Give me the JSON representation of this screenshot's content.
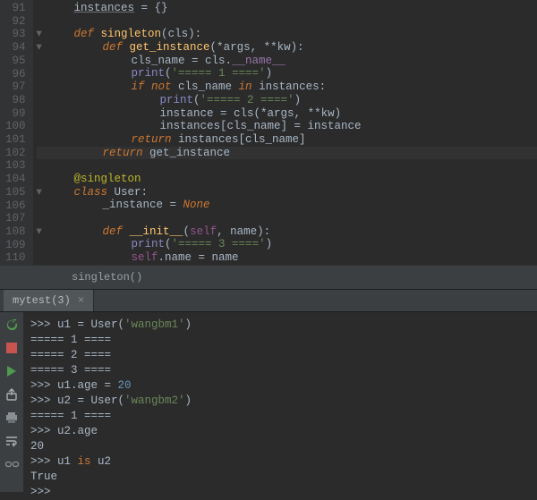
{
  "gutter": {
    "start": 91,
    "end": 110,
    "highlighted": 102
  },
  "code_lines": [
    {
      "n": 91,
      "indent": 1,
      "tokens": [
        [
          "txt und",
          "instances"
        ],
        [
          "txt",
          " = {}"
        ]
      ]
    },
    {
      "n": 92,
      "indent": 1,
      "tokens": []
    },
    {
      "n": 93,
      "indent": 1,
      "fold": true,
      "tokens": [
        [
          "kw",
          "def "
        ],
        [
          "fn",
          "singleton"
        ],
        [
          "txt",
          "("
        ],
        [
          "par",
          "cls"
        ],
        [
          "txt",
          ")"
        ],
        [
          "op",
          ":"
        ]
      ]
    },
    {
      "n": 94,
      "indent": 2,
      "fold": true,
      "tokens": [
        [
          "kw",
          "def "
        ],
        [
          "fn",
          "get_instance"
        ],
        [
          "txt",
          "(*"
        ],
        [
          "par",
          "args"
        ],
        [
          "op",
          ", "
        ],
        [
          "txt",
          "**"
        ],
        [
          "par",
          "kw"
        ],
        [
          "txt",
          ")"
        ],
        [
          "op",
          ":"
        ]
      ]
    },
    {
      "n": 95,
      "indent": 3,
      "tokens": [
        [
          "txt",
          "cls_name = cls."
        ],
        [
          "prp",
          "__name__"
        ]
      ]
    },
    {
      "n": 96,
      "indent": 3,
      "tokens": [
        [
          "bi",
          "print"
        ],
        [
          "txt",
          "("
        ],
        [
          "str",
          "'===== 1 ===='"
        ],
        [
          "txt",
          ")"
        ]
      ]
    },
    {
      "n": 97,
      "indent": 3,
      "tokens": [
        [
          "kw",
          "if not "
        ],
        [
          "txt",
          "cls_name "
        ],
        [
          "kw",
          "in "
        ],
        [
          "txt",
          "instances"
        ],
        [
          "op",
          ":"
        ]
      ]
    },
    {
      "n": 98,
      "indent": 4,
      "tokens": [
        [
          "bi",
          "print"
        ],
        [
          "txt",
          "("
        ],
        [
          "str",
          "'===== 2 ===='"
        ],
        [
          "txt",
          ")"
        ]
      ]
    },
    {
      "n": 99,
      "indent": 4,
      "tokens": [
        [
          "txt",
          "instance = cls(*args"
        ],
        [
          "op",
          ", "
        ],
        [
          "txt",
          "**kw)"
        ]
      ]
    },
    {
      "n": 100,
      "indent": 4,
      "tokens": [
        [
          "txt",
          "instances[cls_name] = instance"
        ]
      ]
    },
    {
      "n": 101,
      "indent": 3,
      "tokens": [
        [
          "kw",
          "return "
        ],
        [
          "txt",
          "instances[cls_name]"
        ]
      ]
    },
    {
      "n": 102,
      "indent": 2,
      "hl": true,
      "tokens": [
        [
          "kw",
          "return "
        ],
        [
          "txt",
          "get_instance"
        ]
      ]
    },
    {
      "n": 103,
      "indent": 1,
      "tokens": []
    },
    {
      "n": 104,
      "indent": 1,
      "tokens": [
        [
          "dec",
          "@singleton"
        ]
      ]
    },
    {
      "n": 105,
      "indent": 1,
      "fold": true,
      "tokens": [
        [
          "kw",
          "class "
        ],
        [
          "txt",
          "User"
        ],
        [
          "op",
          ":"
        ]
      ]
    },
    {
      "n": 106,
      "indent": 2,
      "tokens": [
        [
          "txt",
          "_instance = "
        ],
        [
          "kw",
          "None"
        ]
      ]
    },
    {
      "n": 107,
      "indent": 1,
      "tokens": []
    },
    {
      "n": 108,
      "indent": 2,
      "fold": true,
      "tokens": [
        [
          "kw",
          "def "
        ],
        [
          "fn",
          "__init__"
        ],
        [
          "txt",
          "("
        ],
        [
          "slf",
          "self"
        ],
        [
          "op",
          ", "
        ],
        [
          "par",
          "name"
        ],
        [
          "txt",
          ")"
        ],
        [
          "op",
          ":"
        ]
      ]
    },
    {
      "n": 109,
      "indent": 3,
      "tokens": [
        [
          "bi",
          "print"
        ],
        [
          "txt",
          "("
        ],
        [
          "str",
          "'===== 3 ===='"
        ],
        [
          "txt",
          ")"
        ]
      ]
    },
    {
      "n": 110,
      "indent": 3,
      "tokens": [
        [
          "slf",
          "self"
        ],
        [
          "txt",
          ".name = name"
        ]
      ]
    }
  ],
  "breadcrumb": "singleton()",
  "tab": {
    "label": "mytest(3)"
  },
  "console_lines": [
    [
      [
        "prompt",
        ">>> "
      ],
      [
        "c-var",
        "u1 = User("
      ],
      [
        "c-str",
        "'wangbm1'"
      ],
      [
        "c-var",
        ")"
      ]
    ],
    [
      [
        "c-out",
        "===== 1 ===="
      ]
    ],
    [
      [
        "c-out",
        "===== 2 ===="
      ]
    ],
    [
      [
        "c-out",
        "===== 3 ===="
      ]
    ],
    [
      [
        "prompt",
        ">>> "
      ],
      [
        "c-var",
        "u1.age = "
      ],
      [
        "c-num",
        "20"
      ]
    ],
    [
      [
        "prompt",
        ">>> "
      ],
      [
        "c-var",
        "u2 = User("
      ],
      [
        "c-str",
        "'wangbm2'"
      ],
      [
        "c-var",
        ")"
      ]
    ],
    [
      [
        "c-out",
        "===== 1 ===="
      ]
    ],
    [
      [
        "prompt",
        ">>> "
      ],
      [
        "c-var",
        "u2.age"
      ]
    ],
    [
      [
        "c-out",
        "20"
      ]
    ],
    [
      [
        "prompt",
        ">>> "
      ],
      [
        "c-var",
        "u1 "
      ],
      [
        "c-kw",
        "is"
      ],
      [
        "c-var",
        " u2"
      ]
    ],
    [
      [
        "c-out",
        "True"
      ]
    ],
    [
      [
        "prompt",
        ">>> "
      ]
    ]
  ],
  "icons": {
    "rerun": "rerun-icon",
    "stop": "stop-icon",
    "play": "play-icon",
    "export": "export-icon",
    "print": "print-icon",
    "wrap": "wrap-icon",
    "link": "link-icon"
  }
}
